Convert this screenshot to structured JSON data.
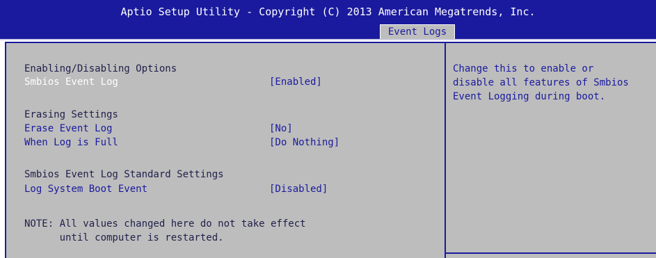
{
  "header": {
    "title": "Aptio Setup Utility - Copyright (C) 2013 American Megatrends, Inc.",
    "active_tab": "Event Logs"
  },
  "main": {
    "section_enable": "Enabling/Disabling Options",
    "smbios_event_log": {
      "label": "Smbios Event Log",
      "value": "[Enabled]"
    },
    "section_erase": "Erasing Settings",
    "erase_event_log": {
      "label": "Erase Event Log",
      "value": "[No]"
    },
    "when_log_full": {
      "label": "When Log is Full",
      "value": "[Do Nothing]"
    },
    "section_standard": "Smbios Event Log Standard Settings",
    "log_system_boot_event": {
      "label": "Log System Boot Event",
      "value": "[Disabled]"
    },
    "note_line1": "NOTE: All values changed here do not take effect",
    "note_line2": "      until computer is restarted."
  },
  "help": {
    "line1": "Change this to enable or",
    "line2": "disable all features of Smbios",
    "line3": "Event Logging during boot."
  },
  "colors": {
    "header_bg": "#1a1a9e",
    "panel_bg": "#bdbdbd",
    "item_text": "#1a1a9e",
    "selected_text": "#ffffff"
  }
}
